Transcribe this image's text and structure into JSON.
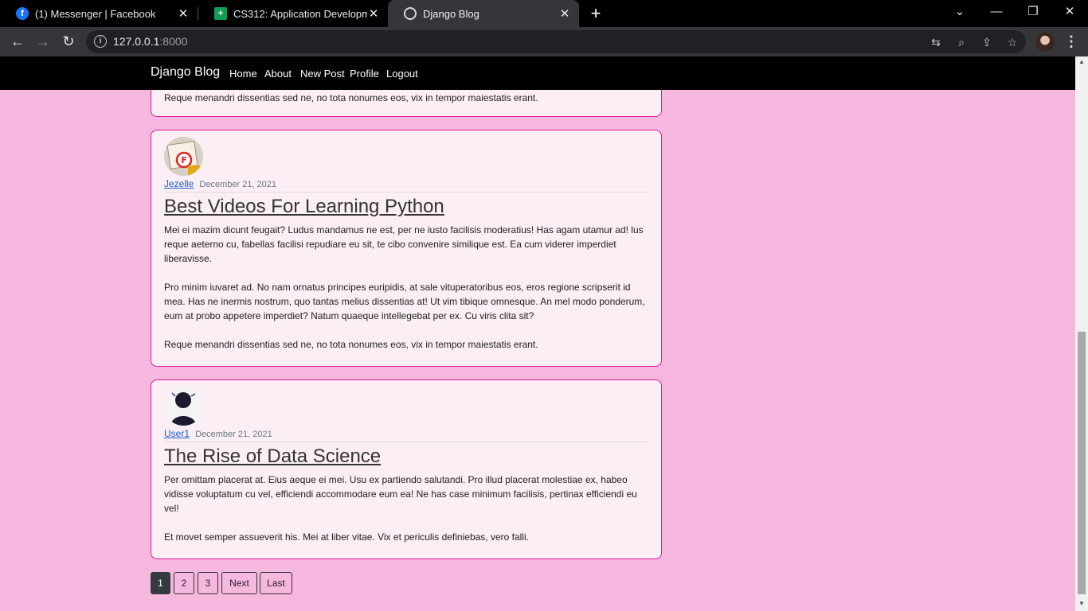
{
  "browser": {
    "tabs": [
      {
        "title": "(1) Messenger | Facebook",
        "icon": "facebook-icon"
      },
      {
        "title": "CS312: Application Development",
        "icon": "google-sheets-icon"
      },
      {
        "title": "Django Blog",
        "icon": "globe-icon"
      }
    ],
    "url_host": "127.0.0.1",
    "url_port": ":8000"
  },
  "site": {
    "brand": "Django Blog",
    "nav": [
      "Home",
      "About",
      "New Post",
      "Profile",
      "Logout"
    ]
  },
  "posts": [
    {
      "partial": true,
      "paragraphs": [
        "Reque menandri dissentias sed ne, no tota nonumes eos, vix in tempor maiestatis erant."
      ]
    },
    {
      "author": "Jezelle",
      "date": "December 21, 2021",
      "title": "Best Videos For Learning Python",
      "paragraphs": [
        "Mei ei mazim dicunt feugait? Ludus mandamus ne est, per ne iusto facilisis moderatius! Has agam utamur ad! lus reque aeterno cu, fabellas facilisi repudiare eu sit, te cibo convenire similique est. Ea cum viderer imperdiet liberavisse.",
        "Pro minim iuvaret ad. No nam ornatus principes euripidis, at sale vituperatoribus eos, eros regione scripserit id mea. Has ne inermis nostrum, quo tantas melius dissentias at! Ut vim tibique omnesque. An mel modo ponderum, eum at probo appetere imperdiet? Natum quaeque intellegebat per ex. Cu viris clita sit?",
        "Reque menandri dissentias sed ne, no tota nonumes eos, vix in tempor maiestatis erant."
      ]
    },
    {
      "author": "User1",
      "date": "December 21, 2021",
      "title": "The Rise of Data Science",
      "paragraphs": [
        "Per omittam placerat at. Eius aeque ei mei. Usu ex partiendo salutandi. Pro illud placerat molestiae ex, habeo vidisse voluptatum cu vel, efficiendi accommodare eum ea! Ne has case minimum facilisis, pertinax efficiendi eu vel!",
        "Et movet semper assueverit his. Mei at liber vitae. Vix et periculis definiebas, vero falli."
      ]
    }
  ],
  "pagination": {
    "pages": [
      "1",
      "2",
      "3"
    ],
    "current": "1",
    "next": "Next",
    "last": "Last"
  },
  "colors": {
    "page_bg": "#f7b8df",
    "card_border": "#e0189a",
    "card_bg": "#fbeef5",
    "navbar": "#000000",
    "author_link": "#1a5fd6"
  }
}
